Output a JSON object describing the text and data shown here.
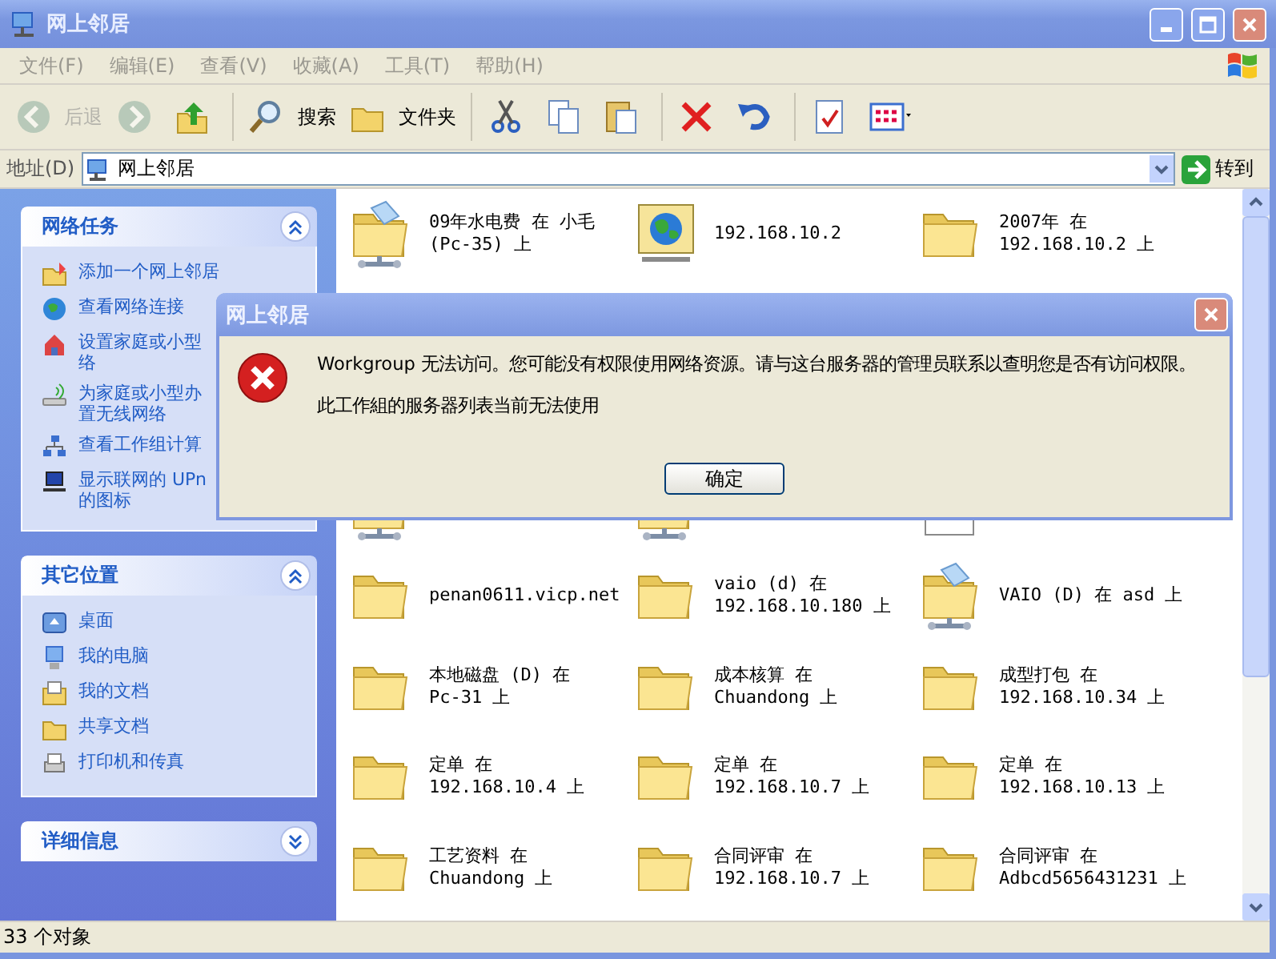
{
  "window": {
    "title": "网上邻居"
  },
  "menu": [
    "文件(F)",
    "编辑(E)",
    "查看(V)",
    "收藏(A)",
    "工具(T)",
    "帮助(H)"
  ],
  "toolbar": [
    {
      "kind": "back",
      "label": "后退",
      "disabled": true
    },
    {
      "kind": "forward",
      "disabled": true
    },
    {
      "kind": "up",
      "disabled": false
    },
    {
      "kind": "search",
      "label": "搜索",
      "disabled": false
    },
    {
      "kind": "folders",
      "label": "文件夹",
      "disabled": false
    },
    {
      "kind": "cut",
      "disabled": false
    },
    {
      "kind": "copy",
      "disabled": false
    },
    {
      "kind": "paste",
      "disabled": false
    },
    {
      "kind": "delete",
      "disabled": false
    },
    {
      "kind": "undo",
      "disabled": false
    },
    {
      "kind": "properties",
      "disabled": false
    },
    {
      "kind": "views",
      "disabled": false
    }
  ],
  "address": {
    "label": "地址(D)",
    "value": "网上邻居",
    "go": "转到"
  },
  "sidebar": [
    {
      "title": "网络任务",
      "expanded": true,
      "items": [
        {
          "kind": "add",
          "lines": [
            "添加一个网上邻居"
          ]
        },
        {
          "kind": "connections",
          "lines": [
            "查看网络连接"
          ]
        },
        {
          "kind": "home",
          "lines": [
            "设置家庭或小型",
            "络"
          ]
        },
        {
          "kind": "wireless",
          "lines": [
            "为家庭或小型办",
            "置无线网络"
          ]
        },
        {
          "kind": "workgroup",
          "lines": [
            "查看工作组计算"
          ]
        },
        {
          "kind": "upnp",
          "lines": [
            "显示联网的 UPn",
            "的图标"
          ]
        }
      ]
    },
    {
      "title": "其它位置",
      "expanded": true,
      "items": [
        {
          "kind": "desktop",
          "lines": [
            "桌面"
          ]
        },
        {
          "kind": "computer",
          "lines": [
            "我的电脑"
          ]
        },
        {
          "kind": "documents",
          "lines": [
            "我的文档"
          ]
        },
        {
          "kind": "folder",
          "lines": [
            "共享文档"
          ]
        },
        {
          "kind": "printer",
          "lines": [
            "打印机和传真"
          ]
        }
      ]
    },
    {
      "title": "详细信息",
      "expanded": false
    }
  ],
  "files_top": [
    {
      "kind": "share",
      "lines": [
        "09年水电费 在 小毛",
        "(Pc-35) 上"
      ]
    },
    {
      "kind": "globe",
      "lines": [
        "192.168.10.2"
      ]
    },
    {
      "kind": "folder",
      "lines": [
        "2007年 在",
        "192.168.10.2 上"
      ]
    }
  ],
  "files_covered": [
    {
      "kind": "share"
    },
    {
      "kind": "share"
    },
    {
      "kind": "document"
    }
  ],
  "file_rows": [
    {
      "items": [
        {
          "kind": "folder",
          "lines": [
            "penan0611.vicp.net"
          ]
        },
        {
          "kind": "folder",
          "lines": [
            "vaio (d) 在",
            "192.168.10.180 上"
          ]
        },
        {
          "kind": "share",
          "lines": [
            "VAIO (D) 在 asd 上"
          ]
        }
      ]
    },
    {
      "items": [
        {
          "kind": "folder",
          "lines": [
            "本地磁盘 (D) 在",
            "Pc-31 上"
          ]
        },
        {
          "kind": "folder",
          "lines": [
            "成本核算 在",
            "Chuandong 上"
          ]
        },
        {
          "kind": "folder",
          "lines": [
            "成型打包 在",
            "192.168.10.34 上"
          ]
        }
      ]
    },
    {
      "items": [
        {
          "kind": "folder",
          "lines": [
            "定单 在",
            "192.168.10.4 上"
          ]
        },
        {
          "kind": "folder",
          "lines": [
            "定单 在",
            "192.168.10.7 上"
          ]
        },
        {
          "kind": "folder",
          "lines": [
            "定单 在",
            "192.168.10.13 上"
          ]
        }
      ]
    },
    {
      "items": [
        {
          "kind": "folder",
          "lines": [
            "工艺资料 在",
            "Chuandong 上"
          ]
        },
        {
          "kind": "folder",
          "lines": [
            "合同评审 在",
            "192.168.10.7 上"
          ]
        },
        {
          "kind": "folder",
          "lines": [
            "合同评审 在",
            "Adbcd5656431231 上"
          ]
        }
      ]
    }
  ],
  "dialog": {
    "title": "网上邻居",
    "message": "Workgroup 无法访问。您可能没有权限使用网络资源。请与这台服务器的管理员联系以查明您是否有访问权限。",
    "detail": "此工作組的服务器列表当前无法使用",
    "button": "确定"
  },
  "status_bar": {
    "text": "33 个对象"
  }
}
